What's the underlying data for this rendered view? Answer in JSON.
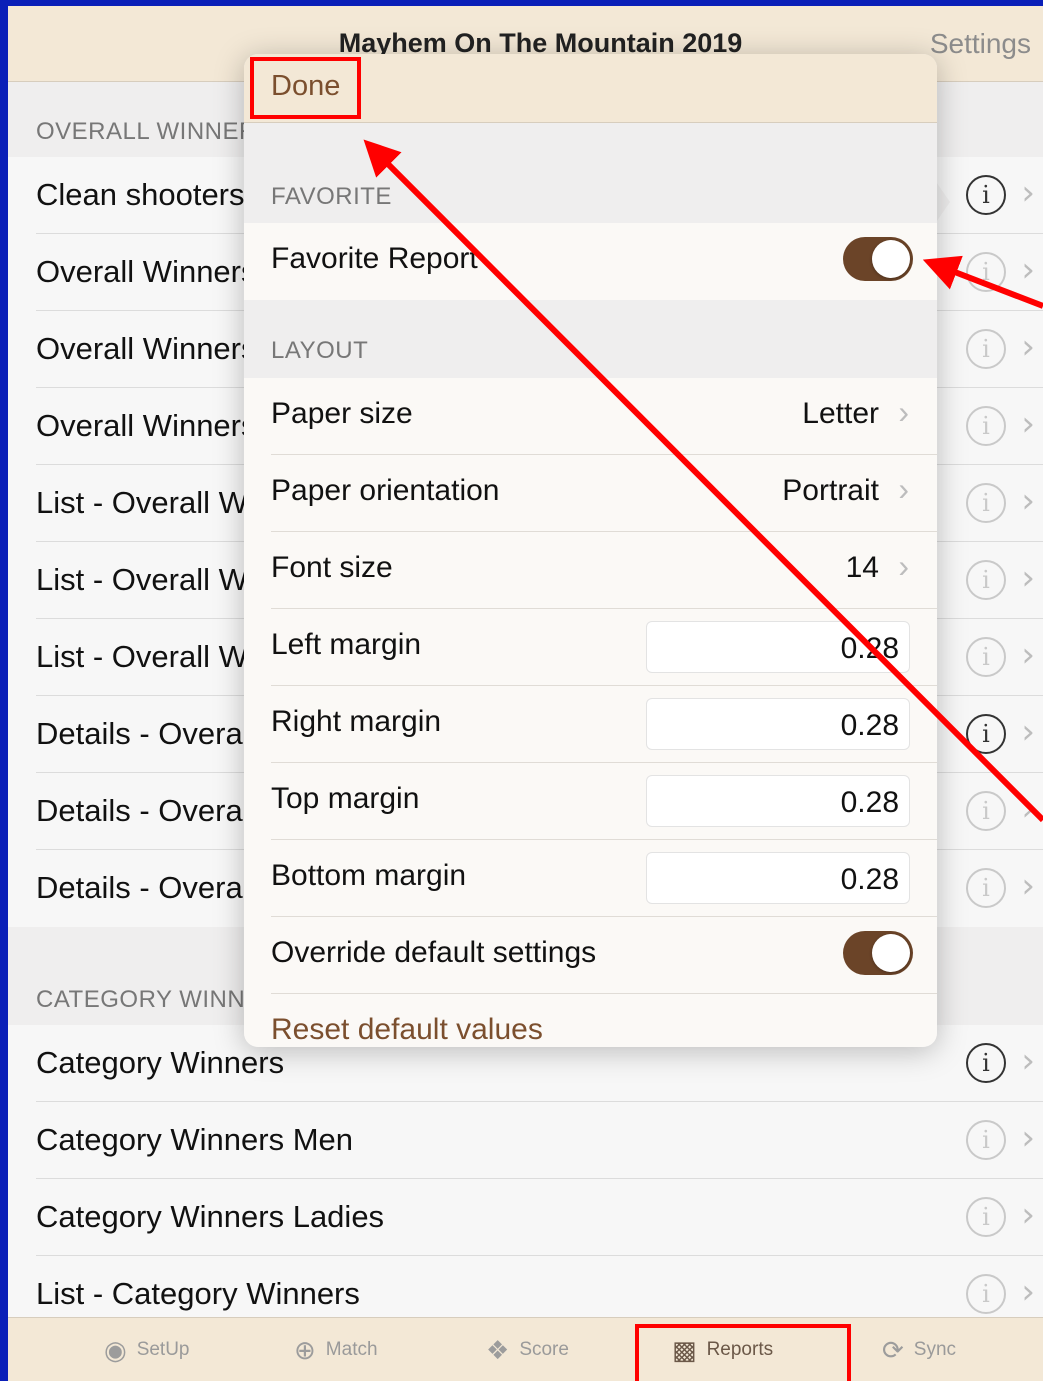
{
  "navbar": {
    "title": "Mayhem On The Mountain 2019",
    "settings": "Settings"
  },
  "overall": {
    "header": "OVERALL WINNERS",
    "rows": [
      "Clean shooters",
      "Overall Winners",
      "Overall Winners",
      "Overall Winners",
      "List - Overall W",
      "List - Overall W",
      "List - Overall W",
      "Details - Overal",
      "Details - Overal",
      "Details - Overal"
    ]
  },
  "category": {
    "header": "CATEGORY WINN",
    "rows": [
      "Category Winners",
      "Category Winners Men",
      "Category Winners Ladies",
      "List - Category Winners"
    ]
  },
  "popover": {
    "done": "Done",
    "favorite_header": "FAVORITE",
    "favorite_label": "Favorite Report",
    "favorite_on": true,
    "layout_header": "LAYOUT",
    "paper_size": {
      "label": "Paper size",
      "value": "Letter"
    },
    "paper_orientation": {
      "label": "Paper orientation",
      "value": "Portrait"
    },
    "font_size": {
      "label": "Font size",
      "value": "14"
    },
    "left_margin": {
      "label": "Left margin",
      "value": "0.28"
    },
    "right_margin": {
      "label": "Right margin",
      "value": "0.28"
    },
    "top_margin": {
      "label": "Top margin",
      "value": "0.28"
    },
    "bottom_margin": {
      "label": "Bottom margin",
      "value": "0.28"
    },
    "override": {
      "label": "Override default settings",
      "on": true
    },
    "reset": "Reset default values"
  },
  "tabs": [
    {
      "label": "SetUp",
      "icon": "hat-icon"
    },
    {
      "label": "Match",
      "icon": "target-icon"
    },
    {
      "label": "Score",
      "icon": "revolver-icon"
    },
    {
      "label": "Reports",
      "icon": "podium-icon",
      "active": true
    },
    {
      "label": "Sync",
      "icon": "sync-icon"
    }
  ],
  "colors": {
    "accent": "#7b4f2e",
    "toggle": "#6b4428",
    "bar": "#f3e8d6",
    "annotation": "#ff0000",
    "frame": "#0a1fb8"
  }
}
